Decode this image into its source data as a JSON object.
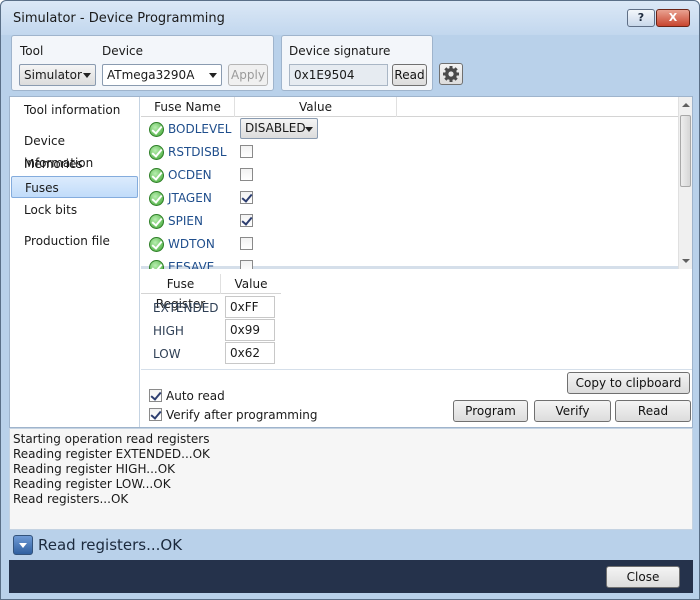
{
  "window": {
    "title": "Simulator - Device Programming",
    "help_label": "?",
    "close_label": "X"
  },
  "tool": {
    "label": "Tool",
    "value": "Simulator"
  },
  "device": {
    "label": "Device",
    "value": "ATmega3290A",
    "apply_label": "Apply"
  },
  "signature": {
    "label": "Device signature",
    "value": "0x1E9504",
    "read_label": "Read",
    "settings_icon": "gear-icon"
  },
  "sidebar": {
    "items": [
      {
        "label": "Tool information"
      },
      {
        "label": "Device information"
      },
      {
        "label": "Memories"
      },
      {
        "label": "Fuses"
      },
      {
        "label": "Lock bits"
      },
      {
        "label": "Production file"
      }
    ],
    "selected": "Fuses"
  },
  "fuses": {
    "columns": [
      "Fuse Name",
      "Value"
    ],
    "rows": [
      {
        "name": "BODLEVEL",
        "value": "DISABLED",
        "type": "select"
      },
      {
        "name": "RSTDISBL",
        "checked": false
      },
      {
        "name": "OCDEN",
        "checked": false
      },
      {
        "name": "JTAGEN",
        "checked": true
      },
      {
        "name": "SPIEN",
        "checked": true
      },
      {
        "name": "WDTON",
        "checked": false
      },
      {
        "name": "EESAVE",
        "checked": false
      }
    ]
  },
  "registers": {
    "columns": [
      "Fuse Register",
      "Value"
    ],
    "rows": [
      {
        "name": "EXTENDED",
        "value": "0xFF"
      },
      {
        "name": "HIGH",
        "value": "0x99"
      },
      {
        "name": "LOW",
        "value": "0x62"
      }
    ]
  },
  "options": {
    "auto_read": {
      "label": "Auto read",
      "checked": true
    },
    "verify_after": {
      "label": "Verify after programming",
      "checked": true
    }
  },
  "actions": {
    "copy_label": "Copy to clipboard",
    "program_label": "Program",
    "verify_label": "Verify",
    "read_label": "Read"
  },
  "log": {
    "lines": [
      "Starting operation read registers",
      "Reading register EXTENDED...OK",
      "Reading register HIGH...OK",
      "Reading register LOW...OK",
      "Read registers...OK"
    ]
  },
  "status": {
    "text": "Read registers...OK"
  },
  "footer": {
    "close_label": "Close"
  }
}
